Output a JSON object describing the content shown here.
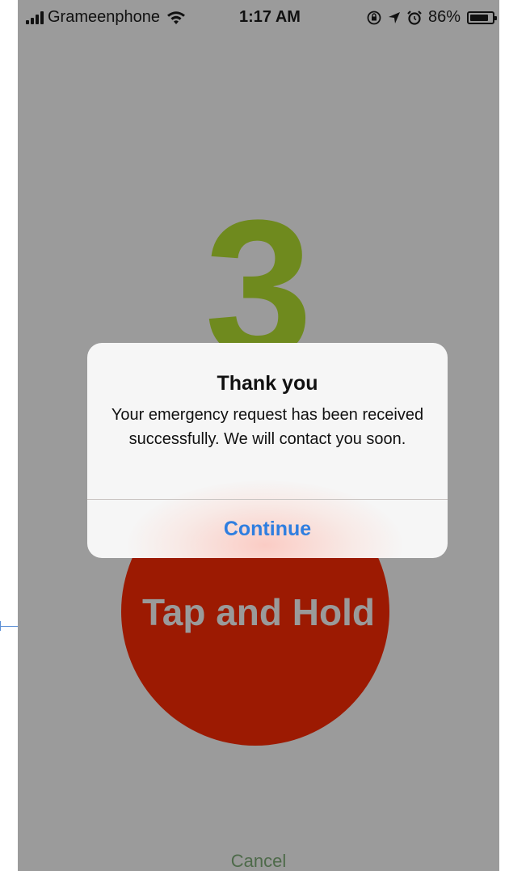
{
  "status_bar": {
    "carrier": "Grameenphone",
    "time": "1:17 AM",
    "battery_text": "86%",
    "battery_level": 0.86,
    "icons": [
      "signal-icon",
      "wifi-icon",
      "orientation-lock-icon",
      "location-icon",
      "alarm-icon",
      "battery-icon"
    ]
  },
  "countdown": {
    "value": "3",
    "color": "#6f8a1e"
  },
  "tap_button": {
    "label": "Tap and Hold",
    "color": "#9c1a02"
  },
  "alert": {
    "title": "Thank you",
    "message": "Your emergency request has been received successfully. We will contact you soon.",
    "button_label": "Continue",
    "button_color": "#2f7ee0"
  },
  "footer": {
    "cancel_label": "Cancel"
  }
}
